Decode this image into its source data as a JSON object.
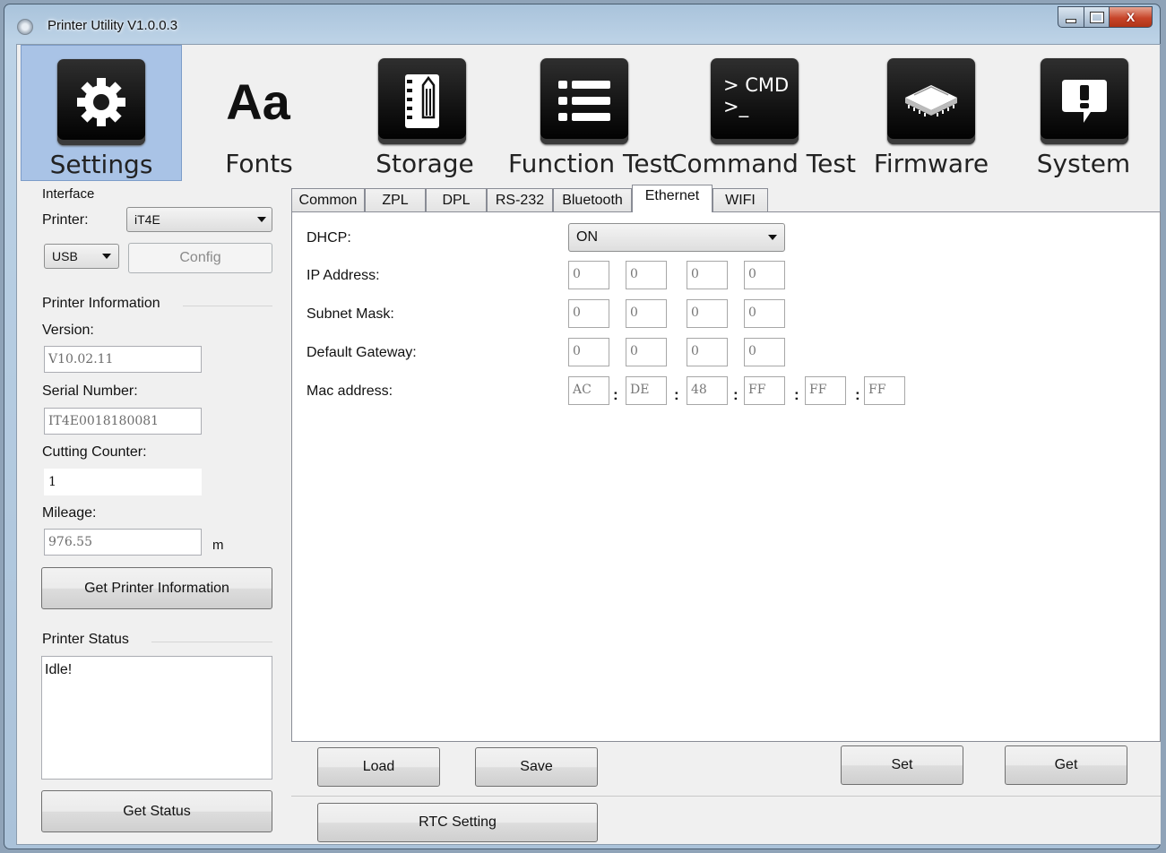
{
  "window": {
    "title": "Printer Utility  V1.0.0.3",
    "caption_buttons": [
      "minimize",
      "maximize",
      "close"
    ],
    "close_glyph": "X"
  },
  "toolbar": {
    "items": [
      {
        "label": "Settings",
        "icon": "gear-icon",
        "active": true
      },
      {
        "label": "Fonts",
        "icon": "font-aa-icon",
        "glyph": "Aa"
      },
      {
        "label": "Storage",
        "icon": "notebook-pencil-icon"
      },
      {
        "label": "Function Test",
        "icon": "list-icon"
      },
      {
        "label": "Command Test",
        "icon": "terminal-icon",
        "line1": "> CMD",
        "line2": ">_"
      },
      {
        "label": "Firmware",
        "icon": "chip-icon"
      },
      {
        "label": "System",
        "icon": "exclamation-bubble-icon"
      }
    ]
  },
  "left_panel": {
    "interface_header": "Interface",
    "printer_label": "Printer:",
    "printer_value": "iT4E",
    "port_value": "USB",
    "config_button": "Config",
    "info_header": "Printer Information",
    "version_label": "Version:",
    "version_value": "V10.02.11",
    "serial_label": "Serial Number:",
    "serial_value": "IT4E0018180081",
    "cutting_label": "Cutting Counter:",
    "cutting_value": "1",
    "mileage_label": "Mileage:",
    "mileage_value": "976.55",
    "mileage_unit": "m",
    "get_info_button": "Get Printer Information",
    "status_header": "Printer Status",
    "status_text": "Idle!",
    "get_status_button": "Get Status"
  },
  "tabs": {
    "items": [
      "Common",
      "ZPL",
      "DPL",
      "RS-232",
      "Bluetooth",
      "Ethernet",
      "WIFI"
    ],
    "active": "Ethernet"
  },
  "ethernet": {
    "dhcp_label": "DHCP:",
    "dhcp_value": "ON",
    "ip_label": "IP Address:",
    "ip": [
      "0",
      "0",
      "0",
      "0"
    ],
    "subnet_label": "Subnet Mask:",
    "subnet": [
      "0",
      "0",
      "0",
      "0"
    ],
    "gateway_label": "Default Gateway:",
    "gateway": [
      "0",
      "0",
      "0",
      "0"
    ],
    "mac_label": "Mac address:",
    "mac": [
      "AC",
      "DE",
      "48",
      "FF",
      "FF",
      "FF"
    ],
    "mac_separator": ":"
  },
  "actions": {
    "load": "Load",
    "save": "Save",
    "set": "Set",
    "get": "Get",
    "rtc": "RTC Setting"
  }
}
